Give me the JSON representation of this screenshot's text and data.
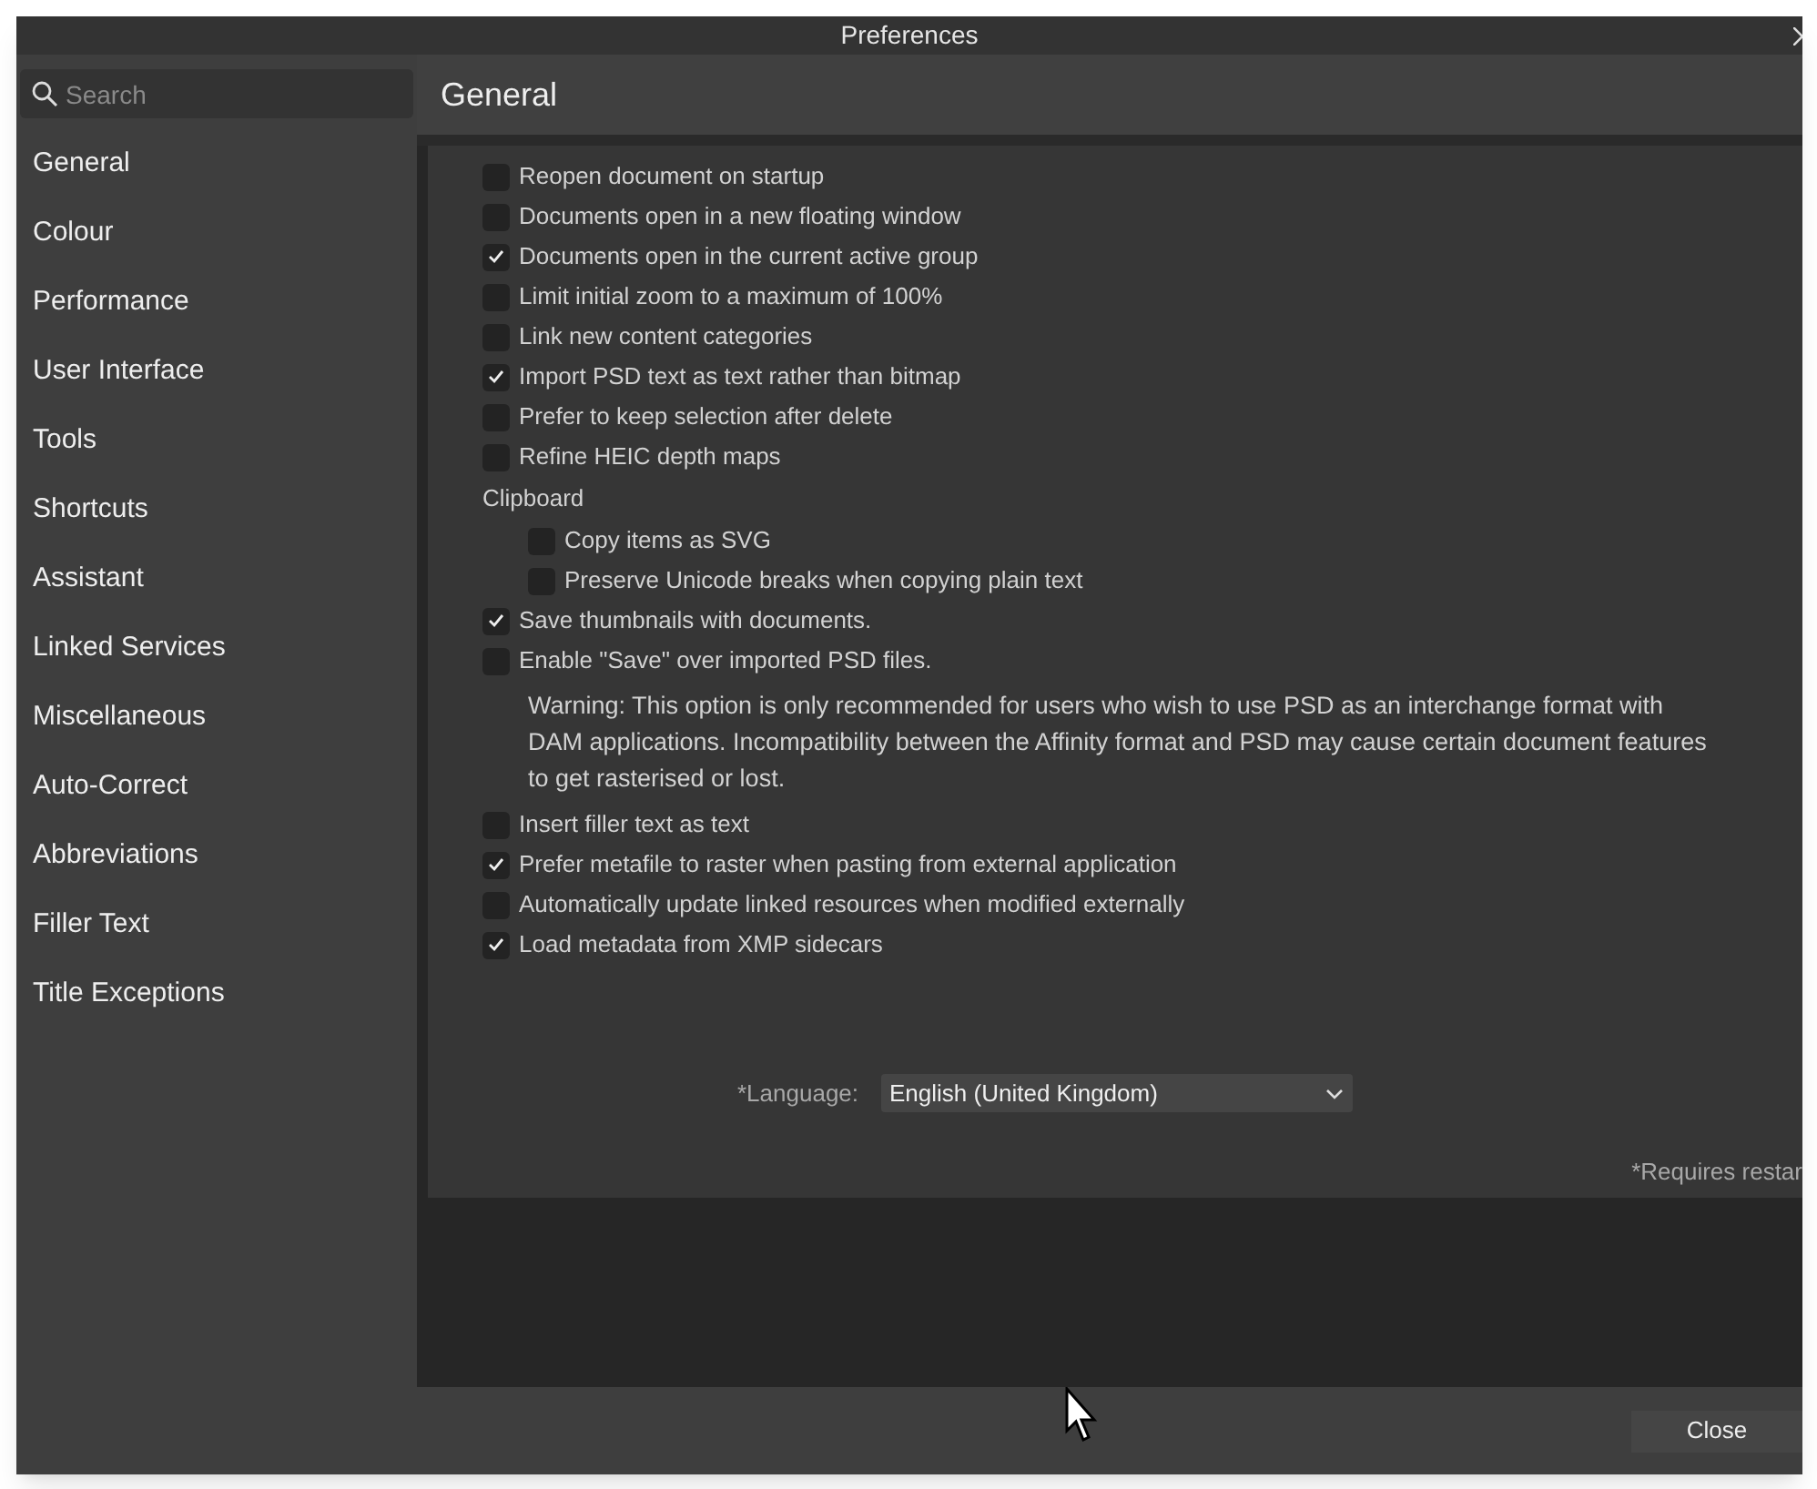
{
  "window": {
    "title": "Preferences"
  },
  "sidebar": {
    "search": {
      "placeholder": "Search"
    },
    "items": [
      {
        "label": "General"
      },
      {
        "label": "Colour"
      },
      {
        "label": "Performance"
      },
      {
        "label": "User Interface"
      },
      {
        "label": "Tools"
      },
      {
        "label": "Shortcuts"
      },
      {
        "label": "Assistant"
      },
      {
        "label": "Linked Services"
      },
      {
        "label": "Miscellaneous"
      },
      {
        "label": "Auto-Correct"
      },
      {
        "label": "Abbreviations"
      },
      {
        "label": "Filler Text"
      },
      {
        "label": "Title Exceptions"
      }
    ]
  },
  "page": {
    "title": "General",
    "options": [
      {
        "kind": "checkbox",
        "label": "Reopen document on startup",
        "checked": false
      },
      {
        "kind": "checkbox",
        "label": "Documents open in a new floating window",
        "checked": false
      },
      {
        "kind": "checkbox",
        "label": "Documents open in the current active group",
        "checked": true
      },
      {
        "kind": "checkbox",
        "label": "Limit initial zoom to a maximum of 100%",
        "checked": false
      },
      {
        "kind": "checkbox",
        "label": "Link new content categories",
        "checked": false
      },
      {
        "kind": "checkbox",
        "label": "Import PSD text as text rather than bitmap",
        "checked": true
      },
      {
        "kind": "checkbox",
        "label": "Prefer to keep selection after delete",
        "checked": false
      },
      {
        "kind": "checkbox",
        "label": "Refine HEIC depth maps",
        "checked": false
      },
      {
        "kind": "heading",
        "label": "Clipboard",
        "children": [
          {
            "kind": "checkbox",
            "label": "Copy items as SVG",
            "checked": false
          },
          {
            "kind": "checkbox",
            "label": "Preserve Unicode breaks when copying plain text",
            "checked": false
          }
        ]
      },
      {
        "kind": "checkbox",
        "label": "Save thumbnails with documents.",
        "checked": true
      },
      {
        "kind": "checkbox",
        "label": "Enable \"Save\" over imported PSD files.",
        "checked": false
      },
      {
        "kind": "note",
        "label": "Warning: This option is only recommended for users who wish to use PSD as an interchange format with DAM applications. Incompatibility between the Affinity format and PSD may cause certain document features to get rasterised or lost."
      },
      {
        "kind": "checkbox",
        "label": "Insert filler text as text",
        "checked": false
      },
      {
        "kind": "checkbox",
        "label": "Prefer metafile to raster when pasting from external application",
        "checked": true
      },
      {
        "kind": "checkbox",
        "label": "Automatically update linked resources when modified externally",
        "checked": false
      },
      {
        "kind": "checkbox",
        "label": "Load metadata from XMP sidecars",
        "checked": true
      }
    ],
    "language": {
      "label": "*Language:",
      "value": "English (United Kingdom)"
    },
    "restart_note": "*Requires restar"
  },
  "buttons": [
    "Close"
  ]
}
